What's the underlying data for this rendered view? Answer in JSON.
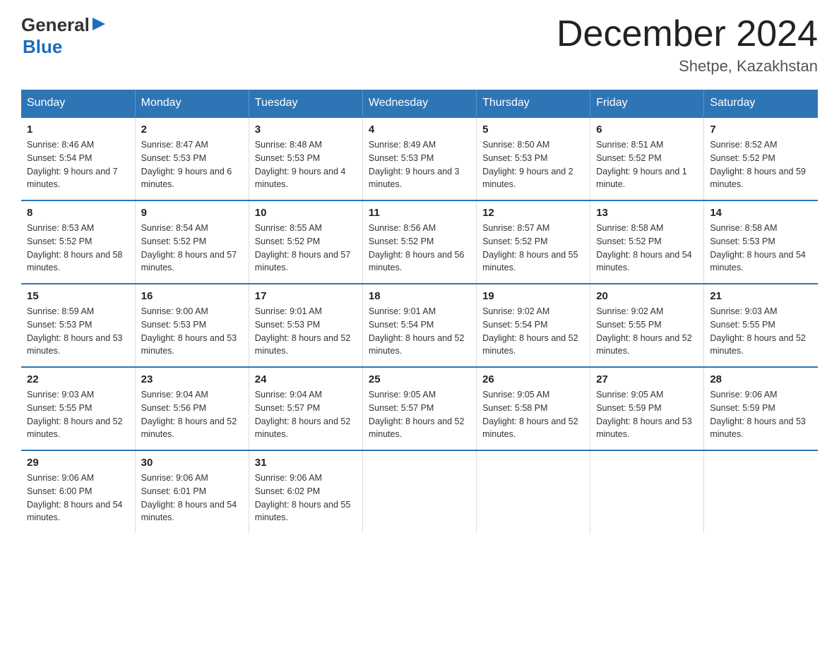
{
  "logo": {
    "text_general": "General",
    "text_blue": "Blue",
    "arrow": "▶"
  },
  "title": "December 2024",
  "location": "Shetpe, Kazakhstan",
  "days_of_week": [
    "Sunday",
    "Monday",
    "Tuesday",
    "Wednesday",
    "Thursday",
    "Friday",
    "Saturday"
  ],
  "weeks": [
    [
      {
        "day": "1",
        "sunrise": "8:46 AM",
        "sunset": "5:54 PM",
        "daylight": "9 hours and 7 minutes."
      },
      {
        "day": "2",
        "sunrise": "8:47 AM",
        "sunset": "5:53 PM",
        "daylight": "9 hours and 6 minutes."
      },
      {
        "day": "3",
        "sunrise": "8:48 AM",
        "sunset": "5:53 PM",
        "daylight": "9 hours and 4 minutes."
      },
      {
        "day": "4",
        "sunrise": "8:49 AM",
        "sunset": "5:53 PM",
        "daylight": "9 hours and 3 minutes."
      },
      {
        "day": "5",
        "sunrise": "8:50 AM",
        "sunset": "5:53 PM",
        "daylight": "9 hours and 2 minutes."
      },
      {
        "day": "6",
        "sunrise": "8:51 AM",
        "sunset": "5:52 PM",
        "daylight": "9 hours and 1 minute."
      },
      {
        "day": "7",
        "sunrise": "8:52 AM",
        "sunset": "5:52 PM",
        "daylight": "8 hours and 59 minutes."
      }
    ],
    [
      {
        "day": "8",
        "sunrise": "8:53 AM",
        "sunset": "5:52 PM",
        "daylight": "8 hours and 58 minutes."
      },
      {
        "day": "9",
        "sunrise": "8:54 AM",
        "sunset": "5:52 PM",
        "daylight": "8 hours and 57 minutes."
      },
      {
        "day": "10",
        "sunrise": "8:55 AM",
        "sunset": "5:52 PM",
        "daylight": "8 hours and 57 minutes."
      },
      {
        "day": "11",
        "sunrise": "8:56 AM",
        "sunset": "5:52 PM",
        "daylight": "8 hours and 56 minutes."
      },
      {
        "day": "12",
        "sunrise": "8:57 AM",
        "sunset": "5:52 PM",
        "daylight": "8 hours and 55 minutes."
      },
      {
        "day": "13",
        "sunrise": "8:58 AM",
        "sunset": "5:52 PM",
        "daylight": "8 hours and 54 minutes."
      },
      {
        "day": "14",
        "sunrise": "8:58 AM",
        "sunset": "5:53 PM",
        "daylight": "8 hours and 54 minutes."
      }
    ],
    [
      {
        "day": "15",
        "sunrise": "8:59 AM",
        "sunset": "5:53 PM",
        "daylight": "8 hours and 53 minutes."
      },
      {
        "day": "16",
        "sunrise": "9:00 AM",
        "sunset": "5:53 PM",
        "daylight": "8 hours and 53 minutes."
      },
      {
        "day": "17",
        "sunrise": "9:01 AM",
        "sunset": "5:53 PM",
        "daylight": "8 hours and 52 minutes."
      },
      {
        "day": "18",
        "sunrise": "9:01 AM",
        "sunset": "5:54 PM",
        "daylight": "8 hours and 52 minutes."
      },
      {
        "day": "19",
        "sunrise": "9:02 AM",
        "sunset": "5:54 PM",
        "daylight": "8 hours and 52 minutes."
      },
      {
        "day": "20",
        "sunrise": "9:02 AM",
        "sunset": "5:55 PM",
        "daylight": "8 hours and 52 minutes."
      },
      {
        "day": "21",
        "sunrise": "9:03 AM",
        "sunset": "5:55 PM",
        "daylight": "8 hours and 52 minutes."
      }
    ],
    [
      {
        "day": "22",
        "sunrise": "9:03 AM",
        "sunset": "5:55 PM",
        "daylight": "8 hours and 52 minutes."
      },
      {
        "day": "23",
        "sunrise": "9:04 AM",
        "sunset": "5:56 PM",
        "daylight": "8 hours and 52 minutes."
      },
      {
        "day": "24",
        "sunrise": "9:04 AM",
        "sunset": "5:57 PM",
        "daylight": "8 hours and 52 minutes."
      },
      {
        "day": "25",
        "sunrise": "9:05 AM",
        "sunset": "5:57 PM",
        "daylight": "8 hours and 52 minutes."
      },
      {
        "day": "26",
        "sunrise": "9:05 AM",
        "sunset": "5:58 PM",
        "daylight": "8 hours and 52 minutes."
      },
      {
        "day": "27",
        "sunrise": "9:05 AM",
        "sunset": "5:59 PM",
        "daylight": "8 hours and 53 minutes."
      },
      {
        "day": "28",
        "sunrise": "9:06 AM",
        "sunset": "5:59 PM",
        "daylight": "8 hours and 53 minutes."
      }
    ],
    [
      {
        "day": "29",
        "sunrise": "9:06 AM",
        "sunset": "6:00 PM",
        "daylight": "8 hours and 54 minutes."
      },
      {
        "day": "30",
        "sunrise": "9:06 AM",
        "sunset": "6:01 PM",
        "daylight": "8 hours and 54 minutes."
      },
      {
        "day": "31",
        "sunrise": "9:06 AM",
        "sunset": "6:02 PM",
        "daylight": "8 hours and 55 minutes."
      },
      null,
      null,
      null,
      null
    ]
  ],
  "labels": {
    "sunrise": "Sunrise:",
    "sunset": "Sunset:",
    "daylight": "Daylight:"
  }
}
